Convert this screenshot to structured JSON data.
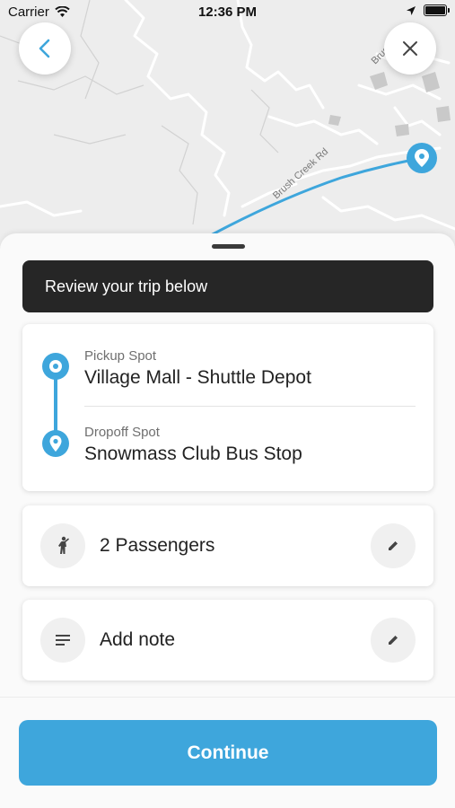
{
  "status_bar": {
    "carrier": "Carrier",
    "time": "12:36 PM",
    "icons": [
      "wifi-icon",
      "location-arrow-icon",
      "battery-icon"
    ]
  },
  "map": {
    "road_label": "Brush Creek Rd",
    "road_label_2": "Brus",
    "route_color": "#3ea6dc",
    "buttons": {
      "back": "chevron-left-icon",
      "close": "close-icon"
    }
  },
  "sheet": {
    "banner": "Review your trip below",
    "pickup": {
      "label": "Pickup Spot",
      "value": "Village Mall - Shuttle Depot",
      "icon": "pickup-pin-icon"
    },
    "dropoff": {
      "label": "Dropoff Spot",
      "value": "Snowmass Club Bus Stop",
      "icon": "dropoff-pin-icon"
    },
    "passengers": {
      "text": "2 Passengers",
      "icon": "person-icon",
      "edit_icon": "pencil-icon"
    },
    "note": {
      "text": "Add note",
      "icon": "notes-icon",
      "edit_icon": "pencil-icon"
    },
    "continue_label": "Continue"
  },
  "colors": {
    "accent": "#3ea6dc",
    "banner_bg": "#262626",
    "map_bg": "#ededed"
  }
}
